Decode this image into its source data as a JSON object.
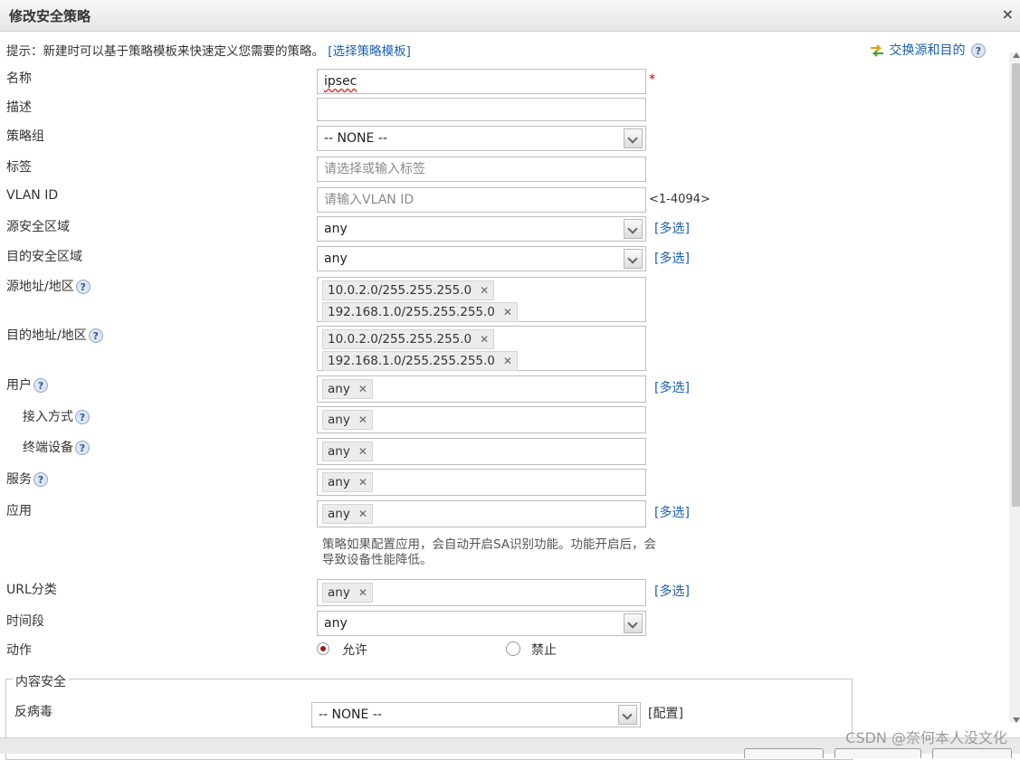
{
  "dialog": {
    "title": "修改安全策略",
    "close": "×"
  },
  "hint": {
    "text": "提示：新建时可以基于策略模板来快速定义您需要的策略。",
    "link": "[选择策略模板]"
  },
  "swap": {
    "label": "交换源和目的"
  },
  "help_glyph": "?",
  "required_mark": "*",
  "name": {
    "label": "名称",
    "value": "ipsec"
  },
  "description": {
    "label": "描述",
    "value": ""
  },
  "policy_group": {
    "label": "策略组",
    "value": "-- NONE --"
  },
  "tags": {
    "label": "标签",
    "placeholder": "请选择或输入标签"
  },
  "vlan": {
    "label": "VLAN ID",
    "placeholder": "请输入VLAN ID",
    "range": "<1-4094>"
  },
  "src_zone": {
    "label": "源安全区域",
    "value": "any",
    "multi": "[多选]"
  },
  "dst_zone": {
    "label": "目的安全区域",
    "value": "any",
    "multi": "[多选]"
  },
  "src_addr": {
    "label": "源地址/地区",
    "tags": [
      "10.0.2.0/255.255.255.0",
      "192.168.1.0/255.255.255.0"
    ]
  },
  "dst_addr": {
    "label": "目的地址/地区",
    "tags": [
      "10.0.2.0/255.255.255.0",
      "192.168.1.0/255.255.255.0"
    ]
  },
  "user": {
    "label": "用户",
    "tag": "any",
    "multi": "[多选]"
  },
  "access_mode": {
    "label": "接入方式",
    "tag": "any"
  },
  "terminal": {
    "label": "终端设备",
    "tag": "any"
  },
  "service": {
    "label": "服务",
    "tag": "any"
  },
  "application": {
    "label": "应用",
    "tag": "any",
    "multi": "[多选]",
    "note": "策略如果配置应用，会自动开启SA识别功能。功能开启后，会导致设备性能降低。"
  },
  "url": {
    "label": "URL分类",
    "tag": "any",
    "multi": "[多选]"
  },
  "schedule": {
    "label": "时间段",
    "value": "any"
  },
  "action": {
    "label": "动作",
    "allow": "允许",
    "deny": "禁止",
    "selected": "允许"
  },
  "content_security": {
    "legend": "内容安全",
    "antivirus_label": "反病毒",
    "antivirus_value": "-- NONE --",
    "config": "[配置]"
  },
  "watermark": "CSDN @奈何本人没文化",
  "colors": {
    "link": "#1a5fb4",
    "required": "#dd0000",
    "radio_selected": "#a3151a",
    "tag_bg": "#ececec"
  }
}
